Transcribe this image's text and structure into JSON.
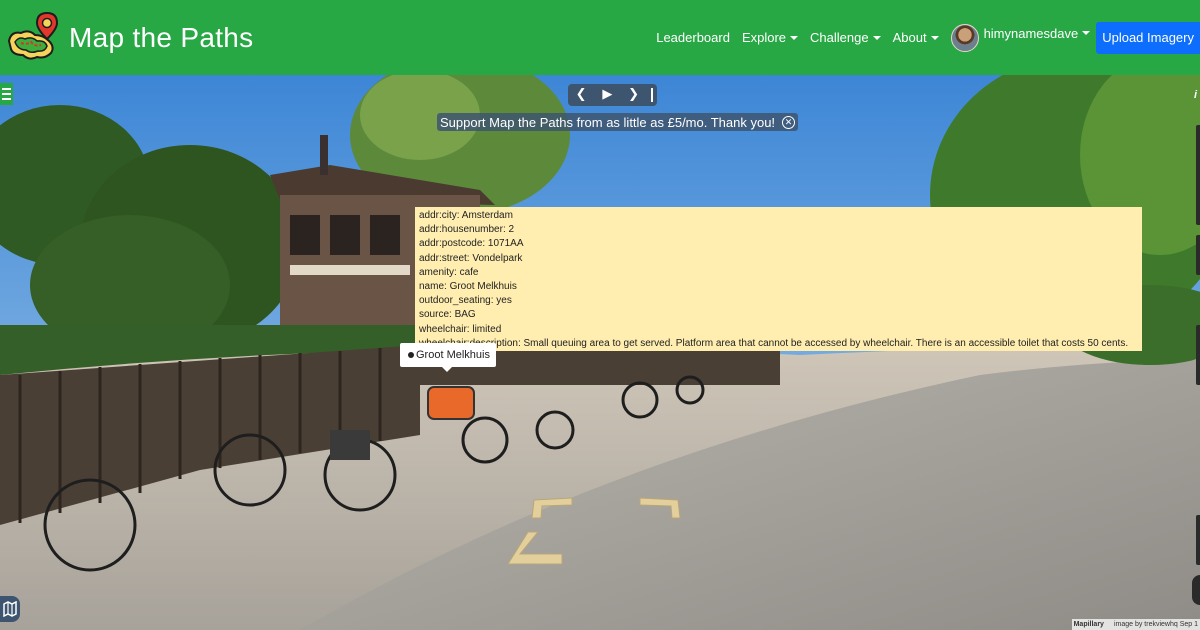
{
  "brand": {
    "title": "Map the Paths",
    "logo_icon": "map-pin-logo-icon"
  },
  "nav": {
    "leaderboard": "Leaderboard",
    "explore": "Explore",
    "challenge": "Challenge",
    "about": "About",
    "username": "himynamesdave",
    "upload": "Upload Imagery"
  },
  "controls": {
    "prev": "❮",
    "play": "▶",
    "next": "❯"
  },
  "banner": {
    "text": "Support Map the Paths from as little as £5/mo. Thank you!",
    "close": "✕"
  },
  "tags": [
    "addr:city: Amsterdam",
    "addr:housenumber: 2",
    "addr:postcode: 1071AA",
    "addr:street: Vondelpark",
    "amenity: cafe",
    "name: Groot Melkhuis",
    "outdoor_seating: yes",
    "source: BAG",
    "wheelchair: limited",
    "wheelchair:description: Small queuing area to get served. Platform area that cannot be accessed by wheelchair. There is an accessible toilet that costs 50 cents."
  ],
  "poi": {
    "label": "Groot Melkhuis"
  },
  "attribution": {
    "brand": "Mapillary",
    "credit": "image by trekviewhq Sep 1"
  },
  "colors": {
    "navbar": "#28a745",
    "upload_button": "#0d6efd",
    "popup": "#ffeeb0",
    "arrow": "#e2cf9b"
  }
}
